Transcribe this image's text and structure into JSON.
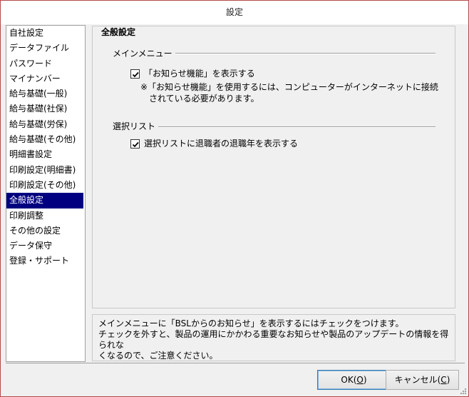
{
  "window": {
    "title": "設定"
  },
  "sidebar": {
    "items": [
      {
        "label": "自社設定"
      },
      {
        "label": "データファイル"
      },
      {
        "label": "パスワード"
      },
      {
        "label": "マイナンバー"
      },
      {
        "label": "給与基礎(一般)"
      },
      {
        "label": "給与基礎(社保)"
      },
      {
        "label": "給与基礎(労保)"
      },
      {
        "label": "給与基礎(その他)"
      },
      {
        "label": "明細書設定"
      },
      {
        "label": "印刷設定(明細書)"
      },
      {
        "label": "印刷設定(その他)"
      },
      {
        "label": "全般設定"
      },
      {
        "label": "印刷調整"
      },
      {
        "label": "その他の設定"
      },
      {
        "label": "データ保守"
      },
      {
        "label": "登録・サポート"
      }
    ],
    "selected_index": 11
  },
  "main": {
    "title": "全般設定",
    "menu_group": {
      "label": "メインメニュー",
      "checkbox_label": "「お知らせ機能」を表示する",
      "checked": true,
      "note_line1": "※「お知らせ機能」を使用するには、コンピューターがインターネットに接続",
      "note_line2": "されている必要があります。"
    },
    "list_group": {
      "label": "選択リスト",
      "checkbox_label": "選択リストに退職者の退職年を表示する",
      "checked": true
    }
  },
  "description": {
    "line1": "メインメニューに「BSLからのお知らせ」を表示するにはチェックをつけます。",
    "line2": "チェックを外すと、製品の運用にかかわる重要なお知らせや製品のアップデートの情報を得られな",
    "line3": "くなるので、ご注意ください。"
  },
  "buttons": {
    "ok_label": "OK(",
    "ok_key": "O",
    "ok_close": ")",
    "cancel_label": "キャンセル(",
    "cancel_key": "C",
    "cancel_close": ")"
  },
  "colors": {
    "selected_bg": "#000080",
    "window_border": "#b44a4a",
    "panel_bg": "#f0f0f0"
  }
}
